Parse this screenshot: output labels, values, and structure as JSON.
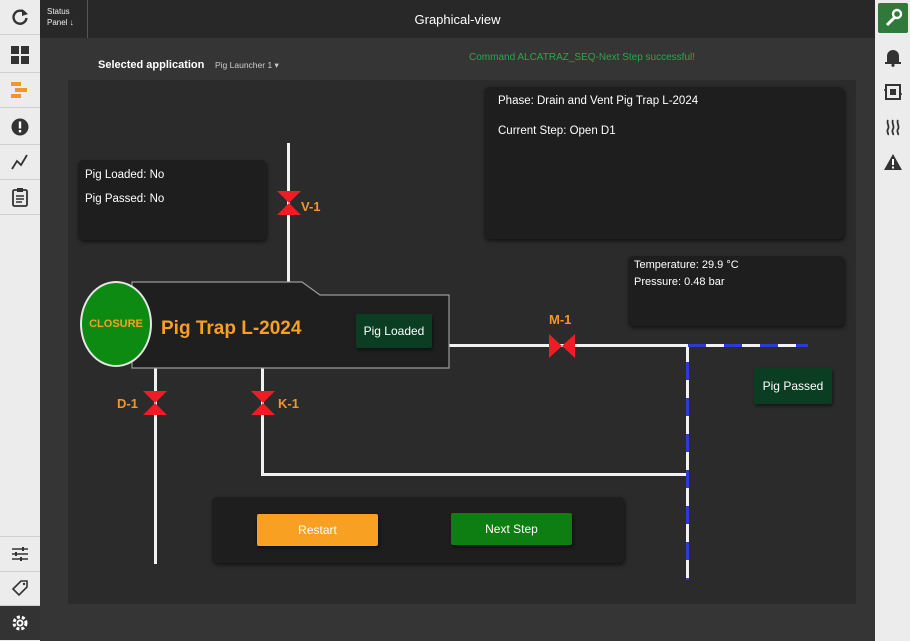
{
  "header": {
    "status_panel_line1": "Status",
    "status_panel_line2": "Panel ↓",
    "title": "Graphical-view"
  },
  "selection": {
    "label": "Selected application",
    "value": "Pig Launcher 1 ▾"
  },
  "command_message": "Command ALCATRAZ_SEQ-Next Step successful!",
  "status_box": {
    "pig_loaded": "Pig Loaded:  No",
    "pig_passed": "Pig Passed:  No"
  },
  "phase_box": {
    "phase": "Phase:  Drain and Vent Pig Trap L-2024",
    "current_step": "Current Step:  Open D1"
  },
  "process_box": {
    "temperature": "Temperature:  29.9 °C",
    "pressure": "Pressure:  0.48 bar"
  },
  "trap": {
    "closure": "CLOSURE",
    "title": "Pig Trap L-2024",
    "pig_loaded_button": "Pig Loaded"
  },
  "pig_passed_button": "Pig Passed",
  "valves": {
    "v1": "V-1",
    "m1": "M-1",
    "d1": "D-1",
    "k1": "K-1"
  },
  "controls": {
    "restart": "Restart",
    "next_step": "Next Step"
  },
  "colors": {
    "accent_orange": "#f7a021",
    "closure_green": "#0d8a12",
    "next_green": "#0e7d12",
    "dark_green_button": "#0a3d21",
    "valve_red": "#ee1c24",
    "message_green": "#2aa84a",
    "blue_dash": "#2b3bd6"
  },
  "icons": {
    "left": [
      "refresh-icon",
      "grid-icon",
      "tree-icon",
      "alert-icon",
      "trend-icon",
      "clipboard-icon",
      "sliders-icon",
      "tag-icon",
      "gear-icon"
    ],
    "right": [
      "wrench-icon",
      "bell-icon",
      "module-icon",
      "heat-icon",
      "warning-icon"
    ]
  }
}
